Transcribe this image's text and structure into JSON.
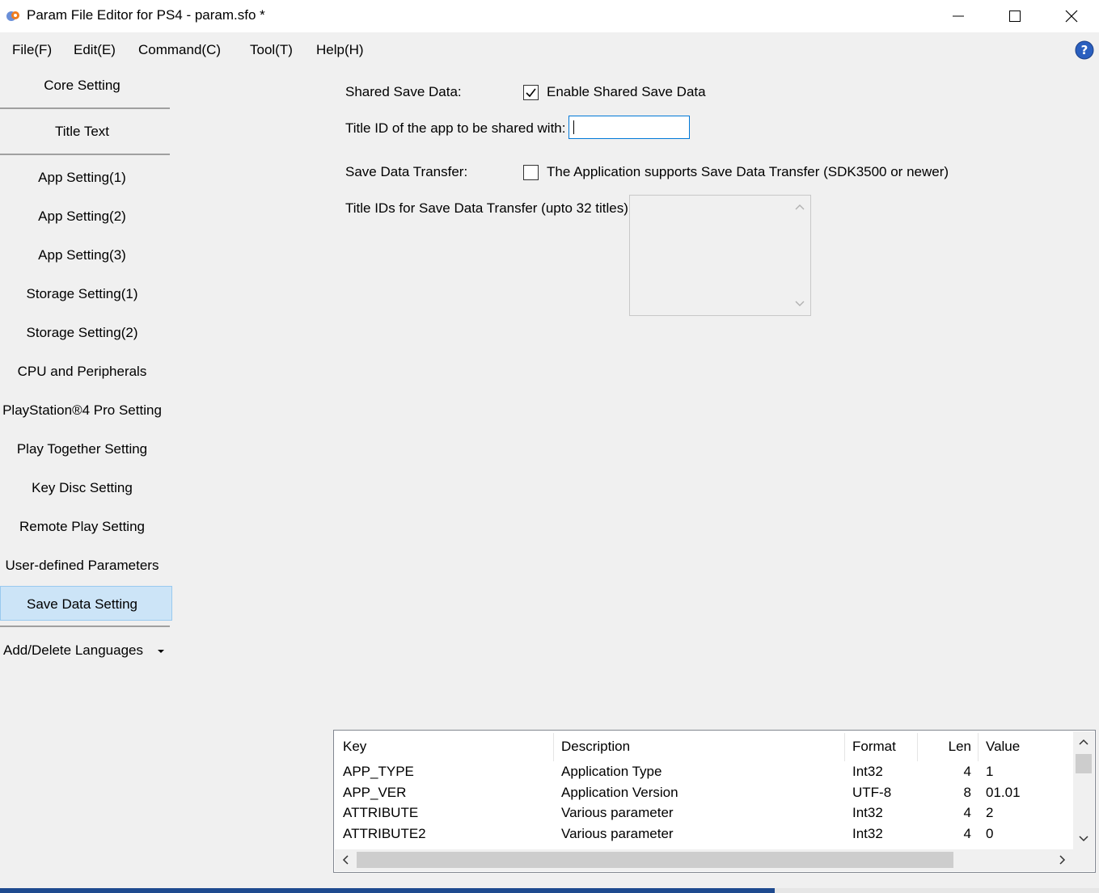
{
  "window": {
    "title": "Param File Editor for PS4 - param.sfo *",
    "icon": "gear-app-icon"
  },
  "menu": [
    {
      "label": "File(F)"
    },
    {
      "label": "Edit(E)"
    },
    {
      "label": "Command(C)"
    },
    {
      "label": "Tool(T)"
    },
    {
      "label": "Help(H)"
    }
  ],
  "sidebar": {
    "items": [
      {
        "label": "Core Setting"
      },
      {
        "label": "Title Text"
      },
      {
        "label": "App Setting(1)"
      },
      {
        "label": "App Setting(2)"
      },
      {
        "label": "App Setting(3)"
      },
      {
        "label": "Storage Setting(1)"
      },
      {
        "label": "Storage Setting(2)"
      },
      {
        "label": "CPU and Peripherals"
      },
      {
        "label": "PlayStation®4 Pro Setting"
      },
      {
        "label": "Play Together Setting"
      },
      {
        "label": "Key Disc Setting"
      },
      {
        "label": "Remote Play Setting"
      },
      {
        "label": "User-defined Parameters"
      },
      {
        "label": "Save Data Setting"
      },
      {
        "label": "Add/Delete Languages"
      }
    ],
    "selected": "Save Data Setting",
    "accent_color": "#cce4f7"
  },
  "form": {
    "shared_save_label": "Shared Save Data:",
    "shared_save_checkbox_label": "Enable Shared Save Data",
    "shared_save_checked": true,
    "title_id_label": "Title ID of the app to be shared with:",
    "title_id_value": "",
    "transfer_label": "Save Data Transfer:",
    "transfer_checkbox_label": "The Application supports Save Data Transfer (SDK3500 or newer)",
    "transfer_checked": false,
    "transfer_ids_label": "Title IDs for Save Data Transfer (upto 32 titles):",
    "transfer_ids_value": ""
  },
  "table": {
    "headers": {
      "key": "Key",
      "description": "Description",
      "format": "Format",
      "len": "Len",
      "value": "Value"
    },
    "rows": [
      {
        "key": "APP_TYPE",
        "description": "Application Type",
        "format": "Int32",
        "len": "4",
        "value": "1"
      },
      {
        "key": "APP_VER",
        "description": "Application Version",
        "format": "UTF-8",
        "len": "8",
        "value": "01.01"
      },
      {
        "key": "ATTRIBUTE",
        "description": "Various parameter",
        "format": "Int32",
        "len": "4",
        "value": "2"
      },
      {
        "key": "ATTRIBUTE2",
        "description": "Various parameter",
        "format": "Int32",
        "len": "4",
        "value": "0"
      }
    ]
  },
  "progress": {
    "fraction": 0.705,
    "color": "#1e4a8f"
  }
}
